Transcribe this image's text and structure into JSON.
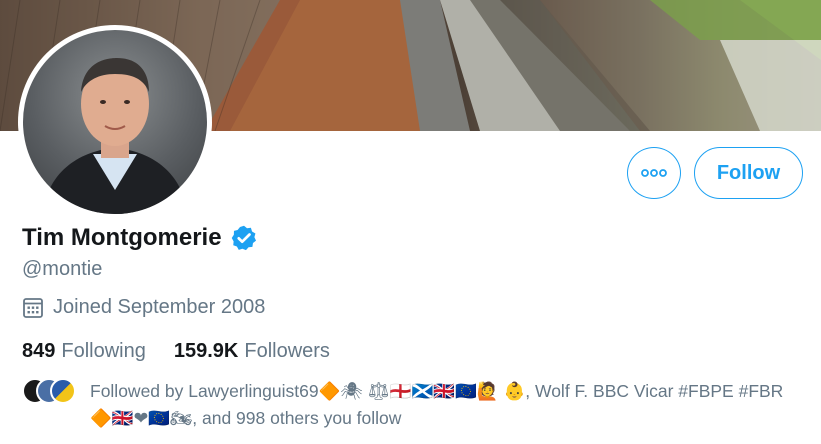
{
  "profile": {
    "display_name": "Tim Montgomerie",
    "handle": "@montie",
    "joined": "Joined September 2008"
  },
  "actions": {
    "more_label": "•••",
    "follow_label": "Follow"
  },
  "stats": {
    "following_count": "849",
    "following_label": "Following",
    "followers_count": "159.9K",
    "followers_label": "Followers"
  },
  "followed_by": {
    "line1": "Followed by Lawyerlinguist69🔶🕷 ⚖🏴󠁧󠁢󠁥󠁮󠁧󠁿🏴󠁧󠁢󠁳󠁣󠁴󠁿🇬🇧🇪🇺🙋 👶, Wolf F. BBC Vicar #FBPE #FBR",
    "line2": "🔶🇬🇧❤🇪🇺🏍, and 998 others you follow"
  },
  "colors": {
    "accent": "#1da1f2",
    "secondary_text": "#657786",
    "primary_text": "#14171a"
  },
  "icons": [
    "more-icon",
    "verified-badge-icon",
    "calendar-icon"
  ]
}
